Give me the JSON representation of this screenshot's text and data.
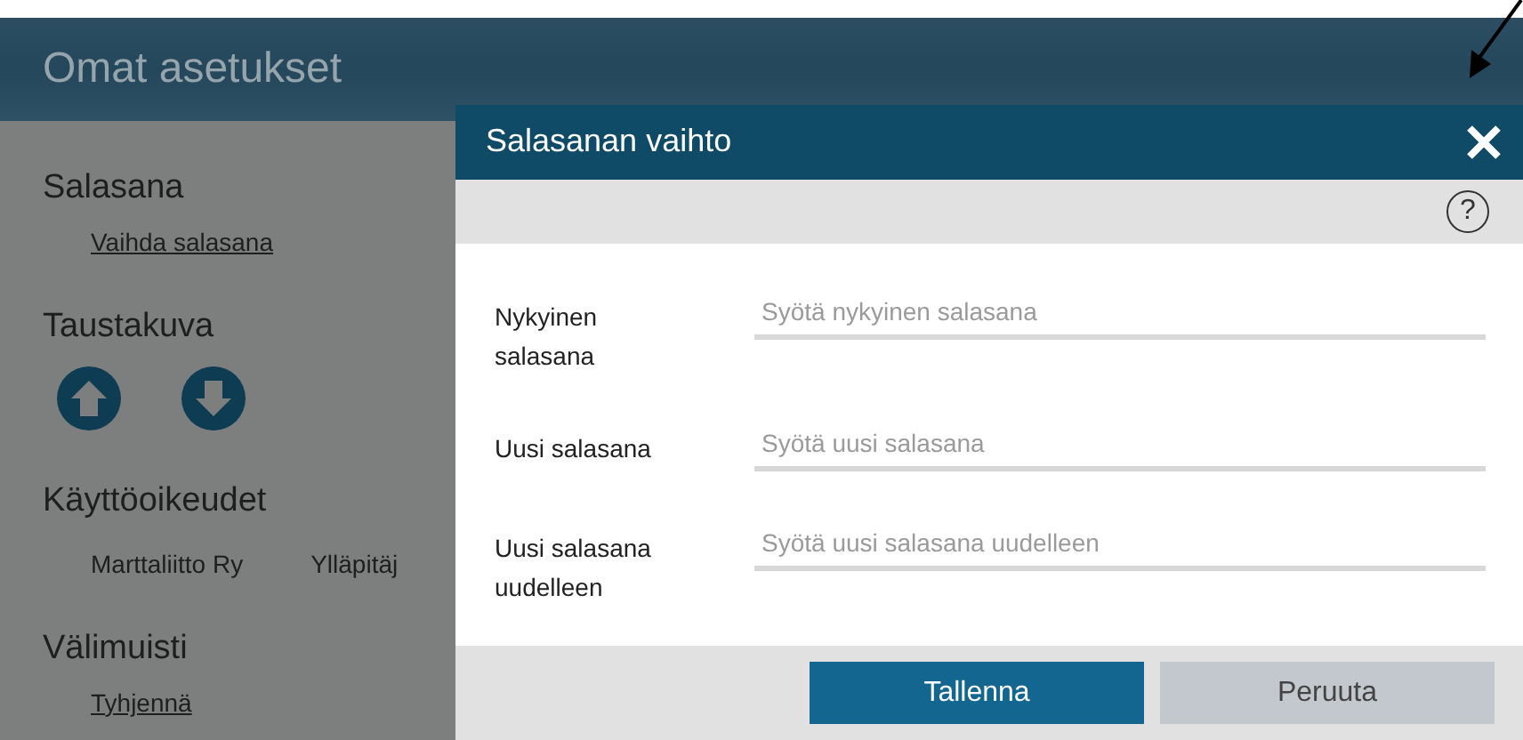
{
  "page": {
    "title": "Omat asetukset",
    "sections": [
      {
        "heading": "Salasana",
        "kind": "link",
        "items": [
          "Vaihda salasana"
        ]
      },
      {
        "heading": "Taustakuva",
        "kind": "icons"
      },
      {
        "heading": "Käyttöoikeudet",
        "kind": "text",
        "items": [
          "Marttaliitto Ry",
          "Ylläpitäj"
        ]
      },
      {
        "heading": "Välimuisti",
        "kind": "link",
        "items": [
          "Tyhjennä"
        ]
      }
    ]
  },
  "dialog": {
    "title": "Salasanan vaihto",
    "help": "?",
    "fields": [
      {
        "label": "Nykyinen salasana",
        "placeholder": "Syötä nykyinen salasana"
      },
      {
        "label": "Uusi salasana",
        "placeholder": "Syötä uusi salasana"
      },
      {
        "label": "Uusi salasana uudelleen",
        "placeholder": "Syötä uusi salasana uudelleen"
      }
    ],
    "buttons": [
      {
        "label": "Tallenna",
        "kind": "primary"
      },
      {
        "label": "Peruuta",
        "kind": "secondary"
      }
    ]
  }
}
